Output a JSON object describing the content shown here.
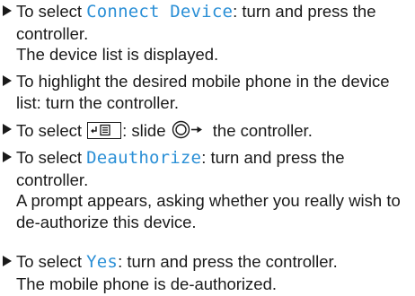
{
  "steps": [
    {
      "prefix": "To select ",
      "highlight": "Connect Device",
      "suffix": ": turn and press the controller.",
      "result": "The device list is displayed."
    },
    {
      "text": "To highlight the desired mobile phone in the device list: turn the controller."
    },
    {
      "prefix": "To select ",
      "softkey_icon": "menu-back-icon",
      "middle": ": slide ",
      "controller_icon": "controller-slide-right-icon",
      "suffix": " the controller."
    },
    {
      "prefix": "To select ",
      "highlight": "Deauthorize",
      "suffix": ": turn and press the controller.",
      "result": "A prompt appears, asking whether you really wish to de-authorize this device."
    },
    {
      "prefix": "To select ",
      "highlight": "Yes",
      "suffix": ": turn and press the controller.",
      "result": "The mobile phone is de-authorized."
    }
  ],
  "colors": {
    "highlight": "#2a8fd6",
    "text": "#1a1a1a"
  }
}
